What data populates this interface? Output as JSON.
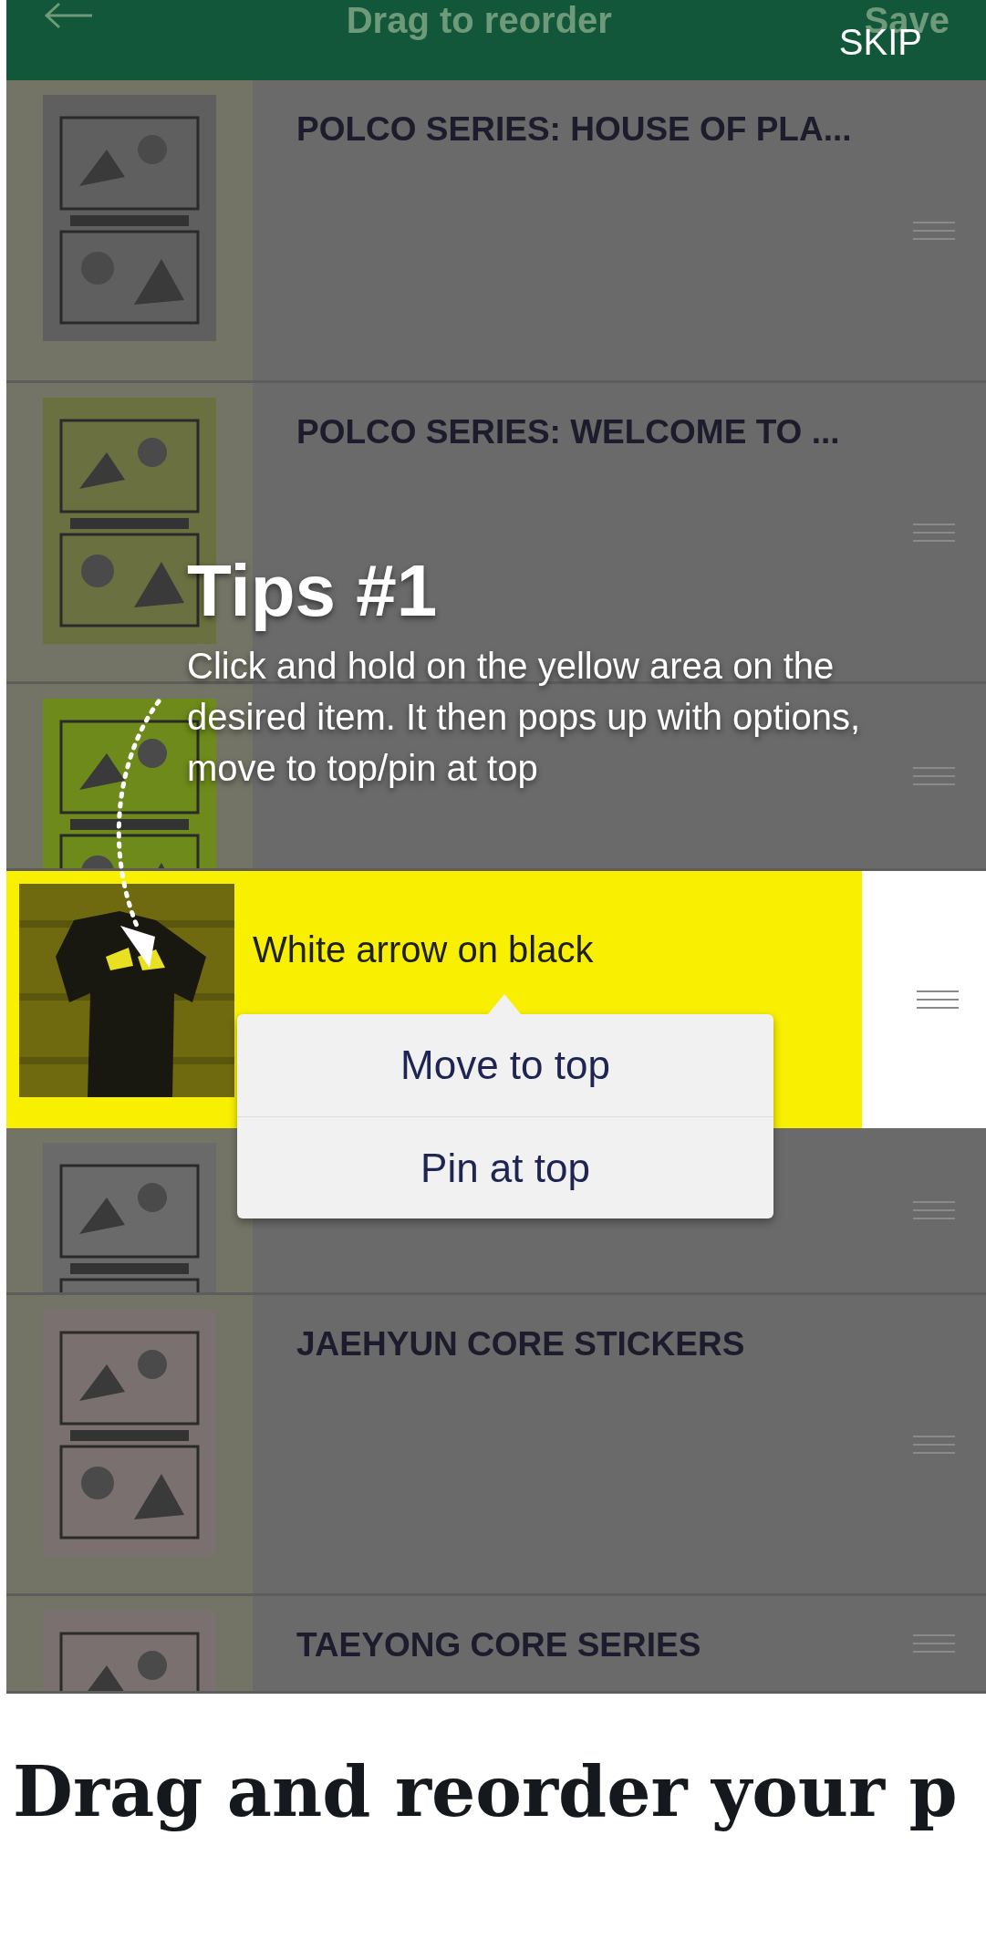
{
  "header": {
    "title": "Drag to reorder",
    "action": "Save",
    "skip": "SKIP"
  },
  "items": [
    {
      "title": "POLCO SERIES: HOUSE OF PLA...",
      "highlighted": false
    },
    {
      "title": "POLCO SERIES: WELCOME TO ...",
      "highlighted": false
    },
    {
      "highlighted": false
    },
    {
      "title": "White arrow on black",
      "highlighted": true
    },
    {
      "highlighted": false
    },
    {
      "title": "JAEHYUN CORE STICKERS",
      "highlighted": false
    },
    {
      "title": "TAEYONG CORE SERIES",
      "highlighted": false
    }
  ],
  "tip": {
    "title": "Tips #1",
    "text": "Click and hold on the yellow area on the desired item. It then pops up with options, move to top/pin at top"
  },
  "menu": [
    "Move to top",
    "Pin at top"
  ],
  "article_heading": "Drag and reorder your p"
}
